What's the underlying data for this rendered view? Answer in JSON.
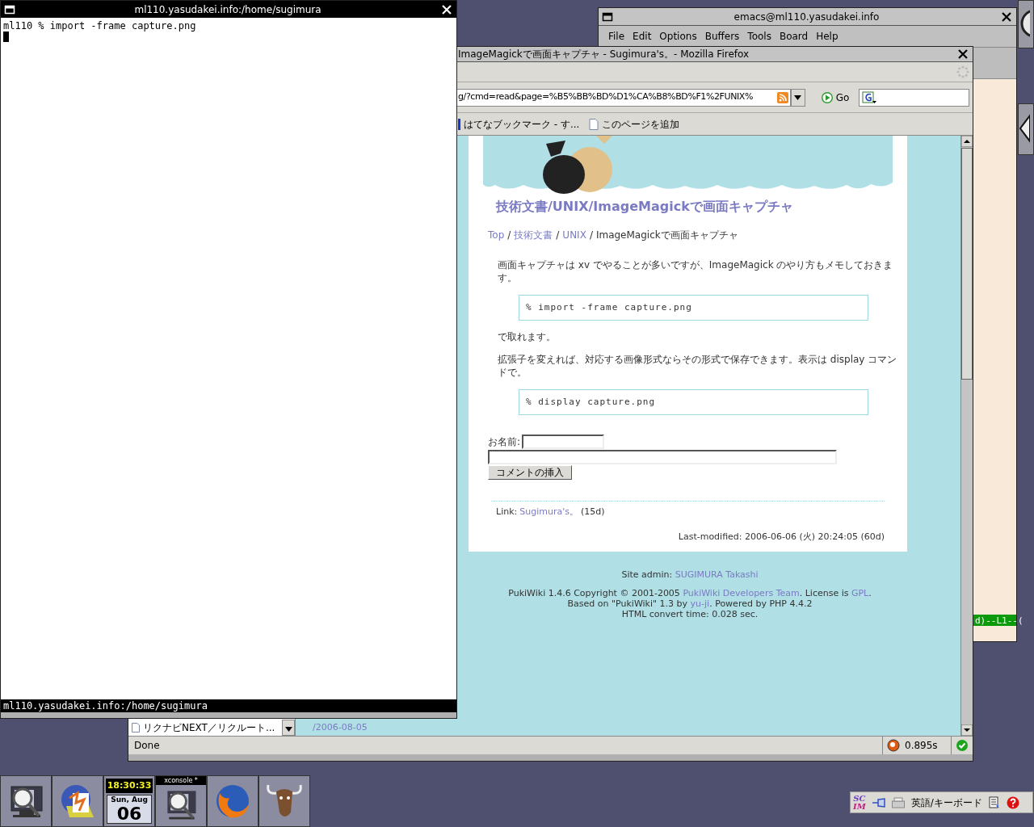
{
  "terminal": {
    "title": "ml110.yasudakei.info:/home/sugimura",
    "lines": [
      "ml110 % import -frame capture.png"
    ],
    "status_line": "ml110.yasudakei.info:/home/sugimura"
  },
  "emacs": {
    "title": "emacs@ml110.yasudakei.info",
    "menu": [
      "File",
      "Edit",
      "Options",
      "Buffers",
      "Tools",
      "Board",
      "Help"
    ],
    "modeline_fragment": "d)--L1--("
  },
  "firefox": {
    "title": "ImageMagickで画面キャプチャ - Sugimura's。- Mozilla Firefox",
    "url": "g/?cmd=read&page=%B5%BB%BD%D1%CA%B8%BD%F1%2FUNIX%",
    "go_label": "Go",
    "bookmarks": [
      "はてなブックマーク - す...",
      "このページを追加"
    ],
    "sidebar_items": [
      "リクナビNEXT／リクルート..."
    ],
    "left_column_link": "/2006-08-05",
    "page": {
      "title": "技術文書/UNIX/ImageMagickで画面キャプチャ",
      "separator": "/",
      "breadcrumb": [
        {
          "text": "Top",
          "link": true
        },
        {
          "text": "技術文書",
          "link": true
        },
        {
          "text": "UNIX",
          "link": true
        },
        {
          "text": "ImageMagickで画面キャプチャ",
          "link": false
        }
      ],
      "blocks": [
        {
          "kind": "paragraph",
          "text": "画面キャプチャは xv でやることが多いですが、ImageMagick のやり方もメモしておきます。"
        },
        {
          "kind": "code",
          "text": "% import -frame capture.png"
        },
        {
          "kind": "paragraph",
          "text": "で取れます。"
        },
        {
          "kind": "paragraph",
          "text": "拡張子を変えれば、対応する画像形式ならその形式で保存できます。表示は display コマンドで。"
        },
        {
          "kind": "code",
          "text": "% display capture.png"
        }
      ],
      "form": {
        "name_label": "お名前:",
        "button": "コメントの挿入"
      },
      "link_line": {
        "label": "Link:",
        "link": "Sugimura's。",
        "age": "(15d)"
      },
      "last_modified": "Last-modified: 2006-06-06 (火) 20:24:05 (60d)"
    },
    "footer": [
      [
        {
          "text": "Site admin: ",
          "link": false
        },
        {
          "text": "SUGIMURA Takashi",
          "link": true
        }
      ],
      [
        {
          "text": "PukiWiki 1.4.6 Copyright © 2001-2005 ",
          "link": false
        },
        {
          "text": "PukiWiki Developers Team",
          "link": true
        },
        {
          "text": ". License is ",
          "link": false
        },
        {
          "text": "GPL",
          "link": true
        },
        {
          "text": ".",
          "link": false
        }
      ],
      [
        {
          "text": "Based on \"PukiWiki\" 1.3 by ",
          "link": false
        },
        {
          "text": "yu-ji",
          "link": true
        },
        {
          "text": ". Powered by PHP 4.4.2",
          "link": false
        }
      ],
      [
        {
          "text": "HTML convert time: 0.028 sec.",
          "link": false
        }
      ]
    ],
    "status": {
      "text": "Done",
      "timing": "0.895s"
    }
  },
  "dock": {
    "clock": {
      "time": "18:30:33",
      "date": "Sun, Aug",
      "day": "06"
    },
    "xconsole_label": "xconsole *"
  },
  "scim": {
    "logo_top": "SC",
    "logo_bottom": "IM",
    "mode": "英語/キーボード"
  }
}
